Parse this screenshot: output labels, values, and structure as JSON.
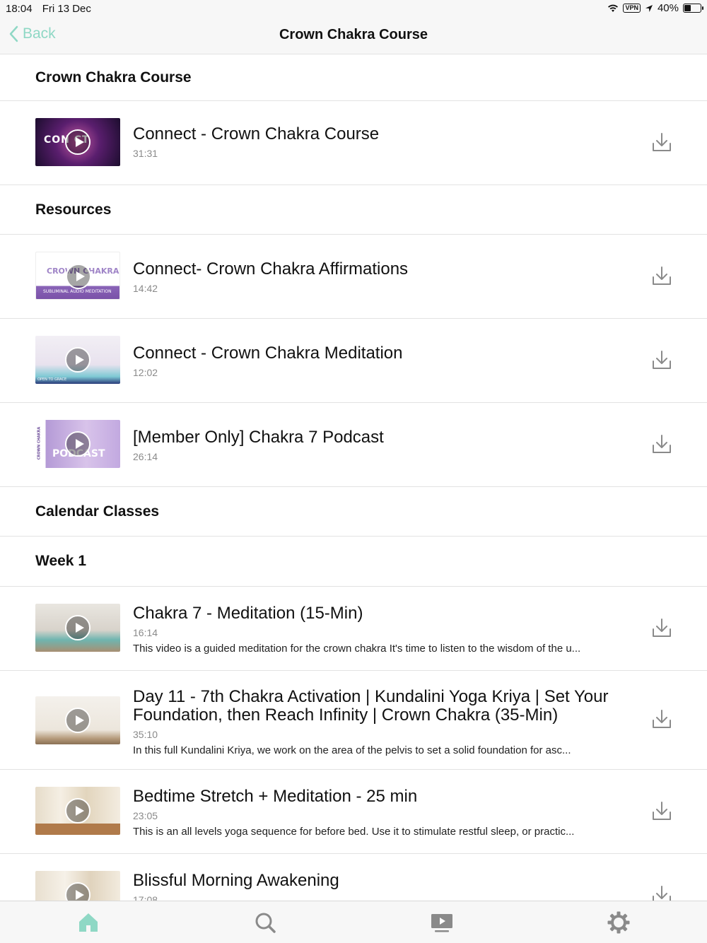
{
  "status_bar": {
    "time": "18:04",
    "date": "Fri 13 Dec",
    "vpn": "VPN",
    "battery": "40%"
  },
  "nav": {
    "back_label": "Back",
    "title": "Crown Chakra Course"
  },
  "colors": {
    "accent": "#8fd8c5",
    "icon_gray": "#8a8a8a"
  },
  "sections": {
    "course": "Crown Chakra Course",
    "resources": "Resources",
    "calendar": "Calendar Classes",
    "week1": "Week 1"
  },
  "course_items": [
    {
      "title": "Connect - Crown Chakra Course",
      "duration": "31:31",
      "thumb_text": "CON      CT"
    }
  ],
  "resource_items": [
    {
      "title": "Connect- Crown Chakra Affirmations",
      "duration": "14:42",
      "thumb_text": "CROWN CHAKRA",
      "thumb_caption": "SUBLIMINAL AUDIO MEDITATION"
    },
    {
      "title": "Connect - Crown Chakra Meditation",
      "duration": "12:02",
      "thumb_caption": "OPEN TO GRACE"
    },
    {
      "title": "[Member Only] Chakra 7 Podcast",
      "duration": "26:14",
      "thumb_text": "PODCAST",
      "thumb_side": "CROWN CHAKRA"
    }
  ],
  "week1_items": [
    {
      "title": "Chakra 7 - Meditation (15-Min)",
      "duration": "16:14",
      "description": "This video is a guided meditation for the crown chakra It's time to listen to the wisdom of the u..."
    },
    {
      "title": "Day 11 - 7th Chakra Activation | Kundalini Yoga Kriya | Set Your Foundation, then Reach Infinity | Crown Chakra (35-Min)",
      "duration": "35:10",
      "description": "In this full Kundalini Kriya, we work on the area of the pelvis to set a solid foundation for asc..."
    },
    {
      "title": "Bedtime Stretch + Meditation - 25 min",
      "duration": "23:05",
      "description": "This is an all levels yoga sequence for before bed. Use it to stimulate restful sleep, or practic..."
    },
    {
      "title": "Blissful Morning Awakening",
      "duration": "17:08"
    }
  ],
  "tabs": [
    "home-icon",
    "search-icon",
    "video-icon",
    "settings-icon"
  ]
}
